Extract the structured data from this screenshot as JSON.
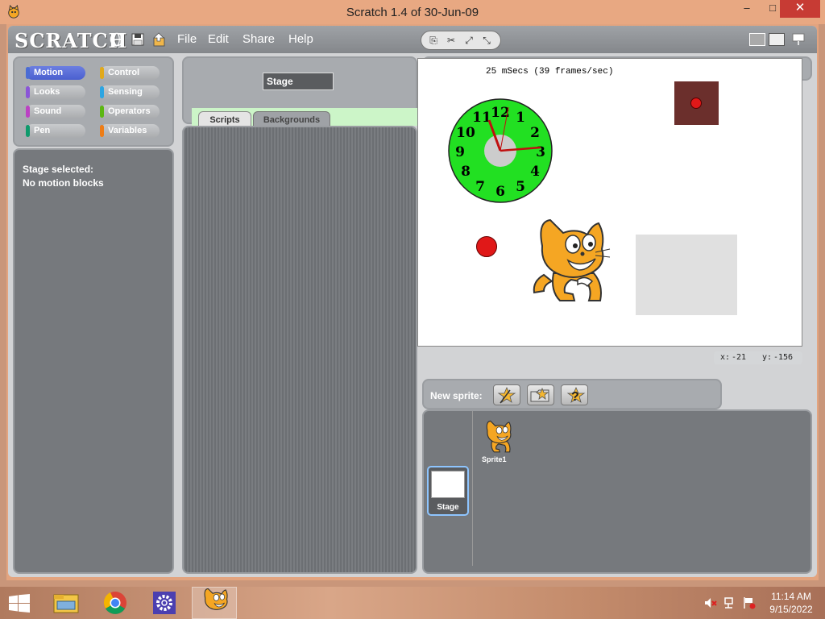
{
  "window": {
    "title": "Scratch 1.4 of 30-Jun-09",
    "minimize": "–",
    "maximize": "□",
    "close": "✕"
  },
  "topbar": {
    "logo": "SCRATCH",
    "menus": [
      "File",
      "Edit",
      "Share",
      "Help"
    ]
  },
  "categories": [
    {
      "label": "Motion",
      "color": "#4a6cd4",
      "selected": true
    },
    {
      "label": "Control",
      "color": "#e1a91a"
    },
    {
      "label": "Looks",
      "color": "#8a55d7"
    },
    {
      "label": "Sensing",
      "color": "#2ca5e2"
    },
    {
      "label": "Sound",
      "color": "#bb42c3"
    },
    {
      "label": "Operators",
      "color": "#5cb712"
    },
    {
      "label": "Pen",
      "color": "#0e9a6c"
    },
    {
      "label": "Variables",
      "color": "#ee7d16"
    }
  ],
  "blocks_palette": {
    "line1": "Stage selected:",
    "line2": "No motion blocks"
  },
  "sprite_info": {
    "name": "Stage",
    "tabs": [
      "Scripts",
      "Backgrounds"
    ]
  },
  "stage": {
    "timer_text": "25 mSecs (39 frames/sec)",
    "clock_numbers": [
      "12",
      "1",
      "2",
      "3",
      "4",
      "5",
      "6",
      "7",
      "8",
      "9",
      "10",
      "11"
    ]
  },
  "coords": {
    "x_label": "x:",
    "x_value": "-21",
    "y_label": "y:",
    "y_value": "-156"
  },
  "new_sprite": {
    "label": "New sprite:"
  },
  "sprites_panel": {
    "stage_label": "Stage",
    "sprites": [
      "Sprite1"
    ]
  },
  "taskbar": {
    "time": "11:14 AM",
    "date": "9/15/2022"
  },
  "colors": {
    "stop": "#e01818",
    "flag": "#1c9b2a",
    "clock_face": "#22e022"
  }
}
